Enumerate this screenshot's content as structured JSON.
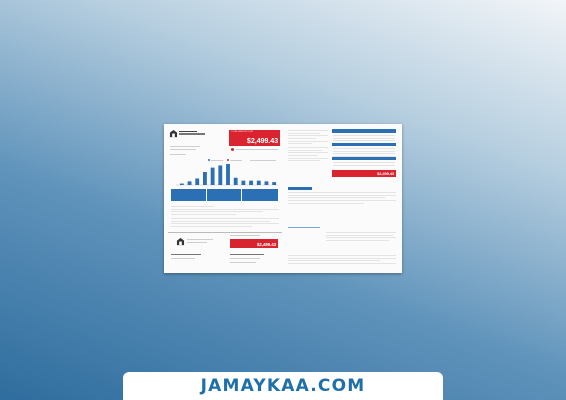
{
  "bill": {
    "amount_due_label": "TOTAL AMOUNT DUE",
    "amount_due": "$2,499.43",
    "amount_due_small": "$2,499.43",
    "amount_due_slip": "$2,499.43"
  },
  "usage_chart": {
    "values": [
      2,
      5,
      9,
      18,
      24,
      27,
      29,
      10,
      6,
      6,
      6,
      5,
      4
    ]
  },
  "watermark": {
    "site": "JAMAYKAA.COM"
  },
  "colors": {
    "accent_red": "#d9232e",
    "accent_blue": "#2b6fb5",
    "banner_text": "#1f6fa8"
  }
}
